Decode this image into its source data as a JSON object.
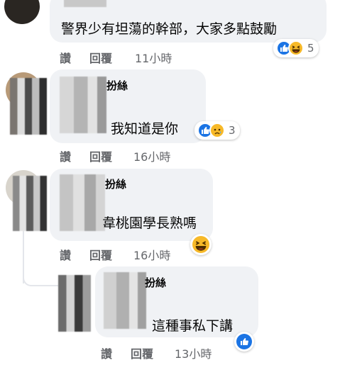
{
  "comments": [
    {
      "text": "警界少有坦蕩的幹部，大家多點鼓勵",
      "like": "讚",
      "reply": "回覆",
      "time": "11小時",
      "reaction_count": "5"
    },
    {
      "name_tail": "扮絲",
      "text": "我知道是你",
      "like": "讚",
      "reply": "回覆",
      "time": "16小時",
      "reaction_count": "3"
    },
    {
      "name_tail": "扮絲",
      "text": "韋桃園學長熟嗎",
      "like": "讚",
      "reply": "回覆",
      "time": "16小時"
    },
    {
      "name_tail": "扮絲",
      "text": "這種事私下講",
      "like": "讚",
      "reply": "回覆",
      "time": "13小時"
    }
  ],
  "colors": {
    "bubble": "#f0f2f5",
    "like_blue": "#1b74e4",
    "emoji_yellow": "#f7b928",
    "meta_gray": "#65676b"
  },
  "icons": [
    "like-reaction-icon",
    "haha-reaction-icon",
    "sad-reaction-icon"
  ]
}
